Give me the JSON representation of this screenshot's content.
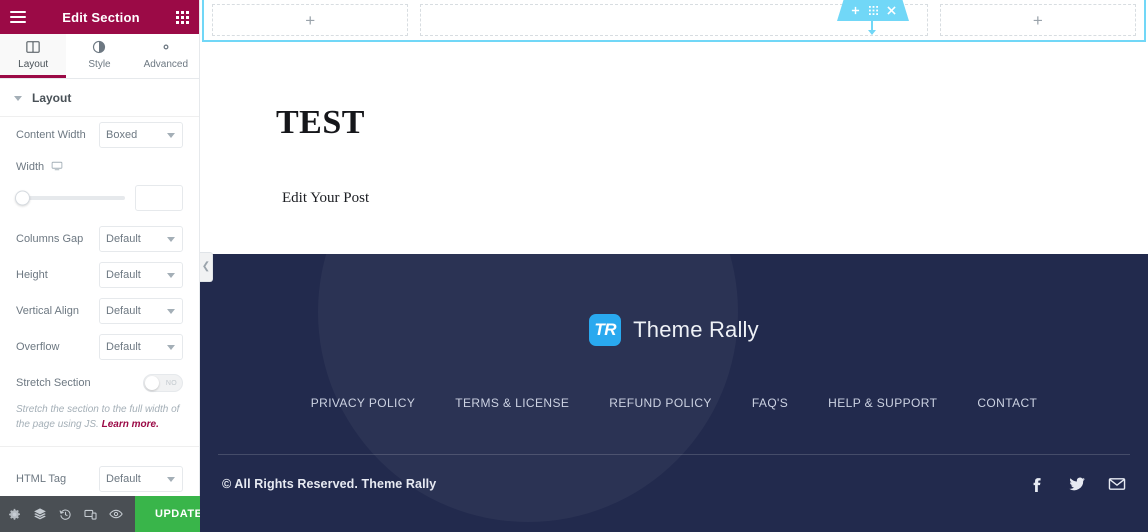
{
  "panel": {
    "header": {
      "title": "Edit Section",
      "menu_icon": "hamburger-icon",
      "apps_icon": "grid-dots-icon"
    },
    "tabs": [
      {
        "label": "Layout",
        "icon": "layout-columns-icon",
        "active": true
      },
      {
        "label": "Style",
        "icon": "contrast-circle-icon",
        "active": false
      },
      {
        "label": "Advanced",
        "icon": "gear-icon",
        "active": false
      }
    ],
    "section": {
      "title": "Layout",
      "caret": "caret-down-icon"
    },
    "controls": [
      {
        "label": "Content Width",
        "value": "Boxed"
      },
      {
        "label": "Columns Gap",
        "value": "Default"
      },
      {
        "label": "Height",
        "value": "Default"
      },
      {
        "label": "Vertical Align",
        "value": "Default"
      },
      {
        "label": "Overflow",
        "value": "Default"
      },
      {
        "label": "HTML Tag",
        "value": "Default"
      }
    ],
    "width_control": {
      "label": "Width",
      "device_icon": "desktop-icon",
      "input_value": ""
    },
    "stretch": {
      "label": "Stretch Section",
      "state_text": "NO",
      "help_text": "Stretch the section to the full width of the page using JS.",
      "link_text": "Learn more."
    },
    "footer": {
      "icons": [
        "gear-icon",
        "layers-icon",
        "history-icon",
        "responsive-mode-icon",
        "preview-eye-icon"
      ],
      "update_label": "UPDATE",
      "caret": "caret-up-icon"
    }
  },
  "canvas": {
    "section_toolbar": {
      "add_icon": "plus-icon",
      "drag_icon": "grid-drag-icon",
      "close_icon": "close-x-icon"
    },
    "columns": [
      {
        "placeholder_icon": "plus-icon"
      },
      {
        "placeholder_icon": ""
      },
      {
        "placeholder_icon": "plus-icon"
      }
    ],
    "collapse_handle": "chevron-left-icon",
    "post": {
      "title": "TEST",
      "subtitle": "Edit Your Post"
    }
  },
  "site_footer": {
    "brand": {
      "mark_text": "TR",
      "name": "Theme Rally"
    },
    "nav": [
      "PRIVACY POLICY",
      "TERMS & LICENSE",
      "REFUND POLICY",
      "FAQ'S",
      "HELP & SUPPORT",
      "CONTACT"
    ],
    "copyright": "© All Rights Reserved. Theme Rally",
    "socials": [
      "facebook-icon",
      "twitter-icon",
      "email-icon"
    ]
  },
  "colors": {
    "panel_header": "#9b0a46",
    "accent_link": "#9b0a46",
    "update_green": "#39b54a",
    "selection_cyan": "#71d7f7",
    "footer_navy": "#222a4d",
    "brand_blue": "#29a9ef"
  }
}
